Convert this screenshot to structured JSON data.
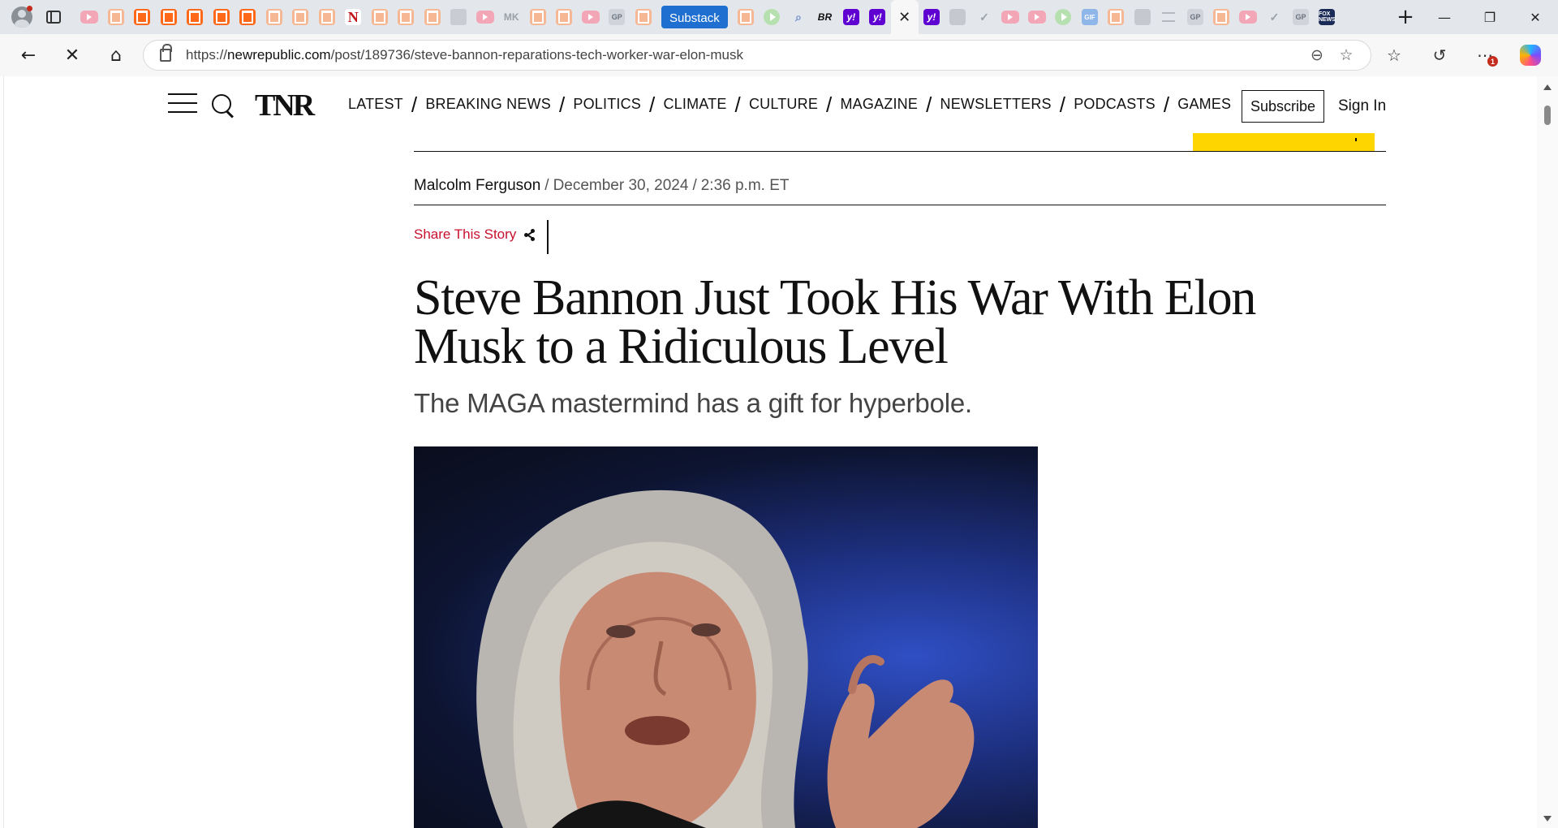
{
  "browser": {
    "tab_substack_label": "Substack",
    "tab_netflix_letter": "N",
    "tab_gp_label": "GP",
    "tab_yahoo_label": "y!",
    "tab_br_label": "BR",
    "tab_gif_label": "GIF",
    "tab_fox_label": "FOX NEWS",
    "tab_mk_label": "MK",
    "url_prefix": "https://",
    "url_host": "newrepublic.com",
    "url_path": "/post/189736/steve-bannon-reparations-tech-worker-war-elon-musk",
    "notification_badge": "1",
    "accent_color": "#1f6fd1"
  },
  "site": {
    "logo": "TNR",
    "nav": [
      "LATEST",
      "BREAKING NEWS",
      "POLITICS",
      "CLIMATE",
      "CULTURE",
      "MAGAZINE",
      "NEWSLETTERS",
      "PODCASTS",
      "GAMES"
    ],
    "subscribe_label": "Subscribe",
    "signin_label": "Sign In",
    "accent_red": "#c8102e",
    "promo_yellow": "#ffd500"
  },
  "article": {
    "author": "Malcolm Ferguson",
    "date": "December 30, 2024",
    "time": "2:36 p.m. ET",
    "share_label": "Share This Story",
    "headline": "Steve Bannon Just Took His War With Elon Musk to a Ridiculous Level",
    "dek": "The MAGA mastermind has a gift for hyperbole.",
    "image_subject": "Steve Bannon speaking, gesturing with raised hand"
  }
}
